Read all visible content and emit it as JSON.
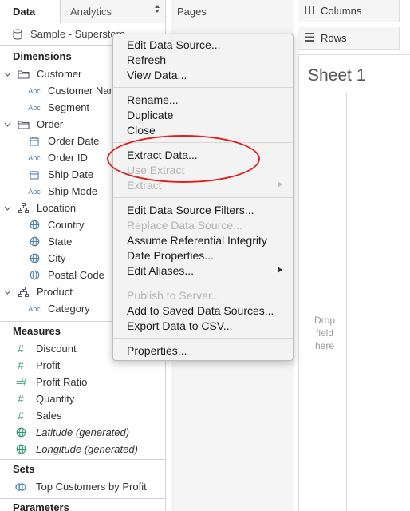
{
  "data_pane": {
    "tabs": [
      {
        "label": "Data",
        "active": true
      },
      {
        "label": "Analytics",
        "active": false
      }
    ],
    "data_source": "Sample - Superstore",
    "dimensions_header": "Dimensions",
    "dimension_groups": [
      {
        "label": "Customer",
        "icon": "folder-icon",
        "fields": [
          {
            "label": "Customer Name",
            "type": "Abc"
          },
          {
            "label": "Segment",
            "type": "Abc"
          }
        ]
      },
      {
        "label": "Order",
        "icon": "folder-icon",
        "fields": [
          {
            "label": "Order Date",
            "type": "calendar"
          },
          {
            "label": "Order ID",
            "type": "Abc"
          },
          {
            "label": "Ship Date",
            "type": "calendar"
          },
          {
            "label": "Ship Mode",
            "type": "Abc"
          }
        ]
      },
      {
        "label": "Location",
        "icon": "hierarchy-icon",
        "fields": [
          {
            "label": "Country",
            "type": "globe"
          },
          {
            "label": "State",
            "type": "globe"
          },
          {
            "label": "City",
            "type": "globe"
          },
          {
            "label": "Postal Code",
            "type": "globe"
          }
        ]
      },
      {
        "label": "Product",
        "icon": "hierarchy-icon",
        "fields": [
          {
            "label": "Category",
            "type": "Abc"
          }
        ]
      }
    ],
    "measures_header": "Measures",
    "measures": [
      {
        "label": "Discount",
        "icon": "#",
        "italic": false
      },
      {
        "label": "Profit",
        "icon": "#",
        "italic": false
      },
      {
        "label": "Profit Ratio",
        "icon": "=#",
        "italic": false
      },
      {
        "label": "Quantity",
        "icon": "#",
        "italic": false
      },
      {
        "label": "Sales",
        "icon": "#",
        "italic": false
      },
      {
        "label": "Latitude (generated)",
        "icon": "globe",
        "italic": true
      },
      {
        "label": "Longitude (generated)",
        "icon": "globe",
        "italic": true
      }
    ],
    "sets_header": "Sets",
    "sets": [
      {
        "label": "Top Customers by Profit"
      }
    ],
    "parameters_header": "Parameters"
  },
  "pages": {
    "label": "Pages"
  },
  "shelves": {
    "columns": "Columns",
    "rows": "Rows"
  },
  "sheet": {
    "title": "Sheet 1",
    "drop_hint": [
      "Drop",
      "field",
      "here"
    ]
  },
  "context_menu": {
    "groups": [
      [
        {
          "label": "Edit Data Source...",
          "enabled": true
        },
        {
          "label": "Refresh",
          "enabled": true
        },
        {
          "label": "View Data...",
          "enabled": true
        }
      ],
      [
        {
          "label": "Rename...",
          "enabled": true
        },
        {
          "label": "Duplicate",
          "enabled": true
        },
        {
          "label": "Close",
          "enabled": true
        }
      ],
      [
        {
          "label": "Extract Data...",
          "enabled": true
        },
        {
          "label": "Use Extract",
          "enabled": false
        },
        {
          "label": "Extract",
          "enabled": false,
          "submenu": true
        }
      ],
      [
        {
          "label": "Edit Data Source Filters...",
          "enabled": true
        },
        {
          "label": "Replace Data Source...",
          "enabled": false
        },
        {
          "label": "Assume Referential Integrity",
          "enabled": true
        },
        {
          "label": "Date Properties...",
          "enabled": true
        },
        {
          "label": "Edit Aliases...",
          "enabled": true,
          "submenu": true
        }
      ],
      [
        {
          "label": "Publish to Server...",
          "enabled": false
        },
        {
          "label": "Add to Saved Data Sources...",
          "enabled": true
        },
        {
          "label": "Export Data to CSV...",
          "enabled": true
        }
      ],
      [
        {
          "label": "Properties...",
          "enabled": true
        }
      ]
    ],
    "highlighted_item": "Extract Data..."
  },
  "colors": {
    "annotation_ellipse": "#e02020",
    "field_icon_blue": "#4a7fb1",
    "measure_icon_green": "#2f9a6e"
  }
}
